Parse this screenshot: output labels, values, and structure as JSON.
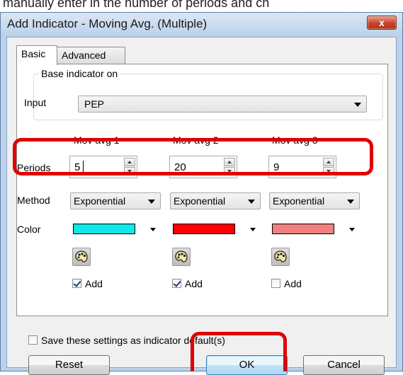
{
  "top_caption": "manually enter in the number of periods and ch",
  "window": {
    "title": "Add Indicator - Moving Avg. (Multiple)",
    "close_glyph": "x"
  },
  "tabs": [
    {
      "label": "Basic"
    },
    {
      "label": "Advanced"
    }
  ],
  "base_group": {
    "legend": "Base indicator on",
    "input_label": "Input",
    "input_value": "PEP"
  },
  "columns": [
    {
      "header": "Mov avg 1",
      "period": "5",
      "method": "Exponential",
      "color": "#11e6e8",
      "add_label": "Add",
      "add_checked": true
    },
    {
      "header": "Mov avg 2",
      "period": "20",
      "method": "Exponential",
      "color": "#ff0000",
      "add_label": "Add",
      "add_checked": true
    },
    {
      "header": "Mov avg 3",
      "period": "9",
      "method": "Exponential",
      "color": "#f08080",
      "add_label": "Add",
      "add_checked": false
    }
  ],
  "row_labels": {
    "periods": "Periods",
    "method": "Method",
    "color": "Color"
  },
  "save_default_label": "Save these settings as indicator default(s)",
  "buttons": {
    "reset": "Reset",
    "ok": "OK",
    "cancel": "Cancel"
  },
  "highlight_color": "#e00000"
}
